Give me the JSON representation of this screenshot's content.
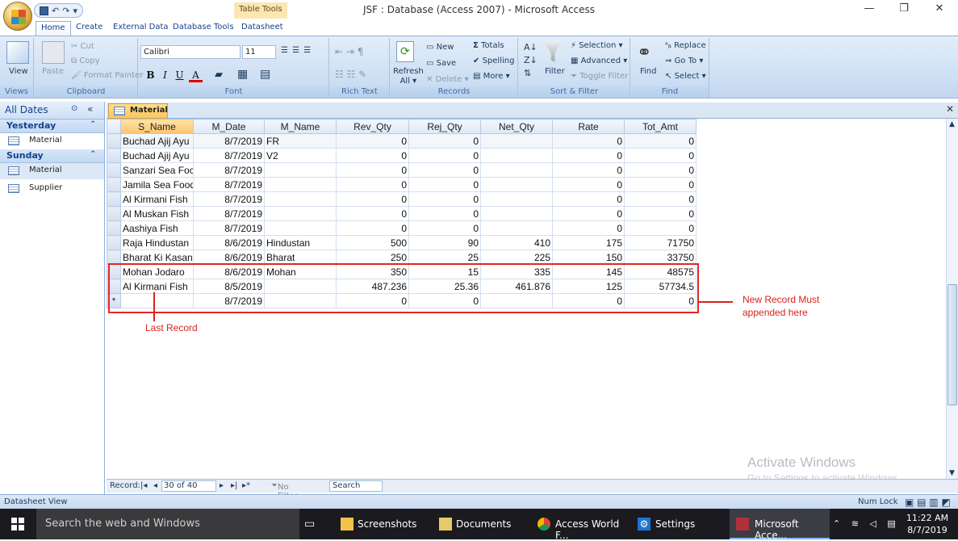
{
  "window": {
    "title": "JSF : Database (Access 2007) - Microsoft Access",
    "context_tab": "Table Tools"
  },
  "tabs": [
    "Home",
    "Create",
    "External Data",
    "Database Tools",
    "Datasheet"
  ],
  "ribbon": {
    "views": {
      "view": "View",
      "label": "Views"
    },
    "clipboard": {
      "paste": "Paste",
      "cut": "Cut",
      "copy": "Copy",
      "format_painter": "Format Painter",
      "label": "Clipboard"
    },
    "font": {
      "name": "Calibri",
      "size": "11",
      "bold": "B",
      "italic": "I",
      "underline": "U",
      "color": "A",
      "label": "Font"
    },
    "rich_text": {
      "label": "Rich Text"
    },
    "records": {
      "refresh": "Refresh",
      "refresh2": "All",
      "new": "New",
      "save": "Save",
      "delete": "Delete",
      "totals": "Totals",
      "spelling": "Spelling",
      "more": "More",
      "label": "Records"
    },
    "sort_filter": {
      "filter": "Filter",
      "selection": "Selection",
      "advanced": "Advanced",
      "toggle": "Toggle Filter",
      "label": "Sort & Filter"
    },
    "find": {
      "find": "Find",
      "replace": "Replace",
      "goto": "Go To",
      "select": "Select",
      "label": "Find"
    }
  },
  "nav": {
    "title": "All Dates",
    "groups": [
      {
        "name": "Yesterday",
        "items": [
          "Material"
        ]
      },
      {
        "name": "Sunday",
        "items": [
          "Material",
          "Supplier"
        ]
      }
    ]
  },
  "doc_tab": "Material",
  "table": {
    "columns": [
      "S_Name",
      "M_Date",
      "M_Name",
      "Rev_Qty",
      "Rej_Qty",
      "Net_Qty",
      "Rate",
      "Tot_Amt"
    ],
    "rows": [
      [
        "Buchad Ajij Ayu",
        "8/7/2019",
        "FR",
        "0",
        "0",
        "",
        "0",
        "0"
      ],
      [
        "Buchad Ajij Ayu",
        "8/7/2019",
        "V2",
        "0",
        "0",
        "",
        "0",
        "0"
      ],
      [
        "Sanzari Sea Foc",
        "8/7/2019",
        "",
        "0",
        "0",
        "",
        "0",
        "0"
      ],
      [
        "Jamila Sea Food",
        "8/7/2019",
        "",
        "0",
        "0",
        "",
        "0",
        "0"
      ],
      [
        "Al Kirmani Fish",
        "8/7/2019",
        "",
        "0",
        "0",
        "",
        "0",
        "0"
      ],
      [
        "Al Muskan Fish",
        "8/7/2019",
        "",
        "0",
        "0",
        "",
        "0",
        "0"
      ],
      [
        "Aashiya Fish",
        "8/7/2019",
        "",
        "0",
        "0",
        "",
        "0",
        "0"
      ],
      [
        "Raja Hindustan",
        "8/6/2019",
        "Hindustan",
        "500",
        "90",
        "410",
        "175",
        "71750"
      ],
      [
        "Bharat Ki Kasan",
        "8/6/2019",
        "Bharat",
        "250",
        "25",
        "225",
        "150",
        "33750"
      ],
      [
        "Mohan Jodaro",
        "8/6/2019",
        "Mohan",
        "350",
        "15",
        "335",
        "145",
        "48575"
      ],
      [
        "Al Kirmani Fish",
        "8/5/2019",
        "",
        "487.236",
        "25.36",
        "461.876",
        "125",
        "57734.5"
      ],
      [
        "",
        "8/7/2019",
        "",
        "0",
        "0",
        "",
        "0",
        "0"
      ]
    ],
    "new_row_marker": "*"
  },
  "annotations": {
    "last_record": "Last Record",
    "new_record_1": "New Record Must",
    "new_record_2": "appended here"
  },
  "record_nav": {
    "label": "Record:",
    "position": "30 of 40",
    "filter": "No Filter",
    "search": "Search"
  },
  "status": {
    "left": "Datasheet View",
    "right": "Num Lock"
  },
  "watermark": {
    "line1": "Activate Windows",
    "line2": "Go to Settings to activate Windows."
  },
  "taskbar": {
    "search_placeholder": "Search the web and Windows",
    "items": [
      "Screenshots",
      "Documents",
      "Access World F...",
      "Settings",
      "Microsoft Acce..."
    ],
    "time": "11:22 AM",
    "date": "8/7/2019"
  }
}
